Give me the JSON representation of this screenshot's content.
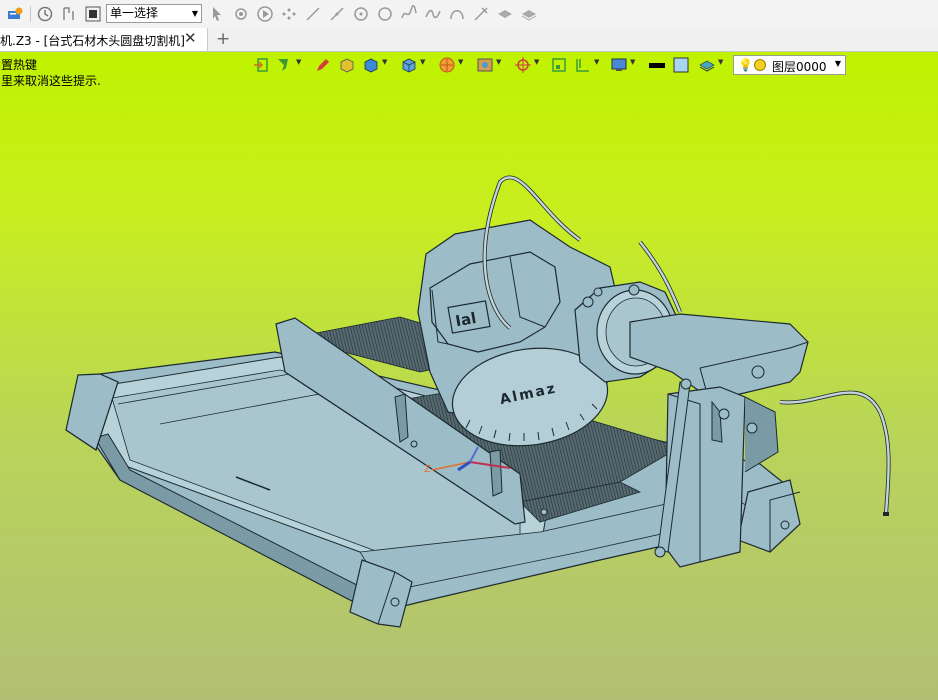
{
  "toolbar": {
    "select_mode": "单一选择",
    "icons": [
      "hotkey-icon",
      "history-icon",
      "filter-icon",
      "stop-icon",
      "pointer-icon",
      "snap-icon",
      "play-icon",
      "points-icon",
      "line-icon",
      "line2-icon",
      "circle-center-icon",
      "circle-icon",
      "spline-icon",
      "curve-icon",
      "arc-icon",
      "trim-icon",
      "plane-icon",
      "plane2-icon"
    ]
  },
  "tabs": {
    "doc_title": "机.Z3 - [台式石材木头圆盘切割机]",
    "close_glyph": "✕",
    "new_tab_glyph": "+"
  },
  "hints": {
    "line1": "置热键",
    "line2": "里来取消这些提示."
  },
  "view_toolbar": {
    "layer_name": "图层0000"
  },
  "model": {
    "blade_brand": "Almaz",
    "motor_label": "Ial",
    "colors": {
      "body": "#9cbcc7",
      "body_dark": "#7a9ba6",
      "body_light": "#b8d2da",
      "outline": "#1c2a30",
      "mesh": "#3f4f55",
      "cable": "#c4d4d8"
    }
  }
}
